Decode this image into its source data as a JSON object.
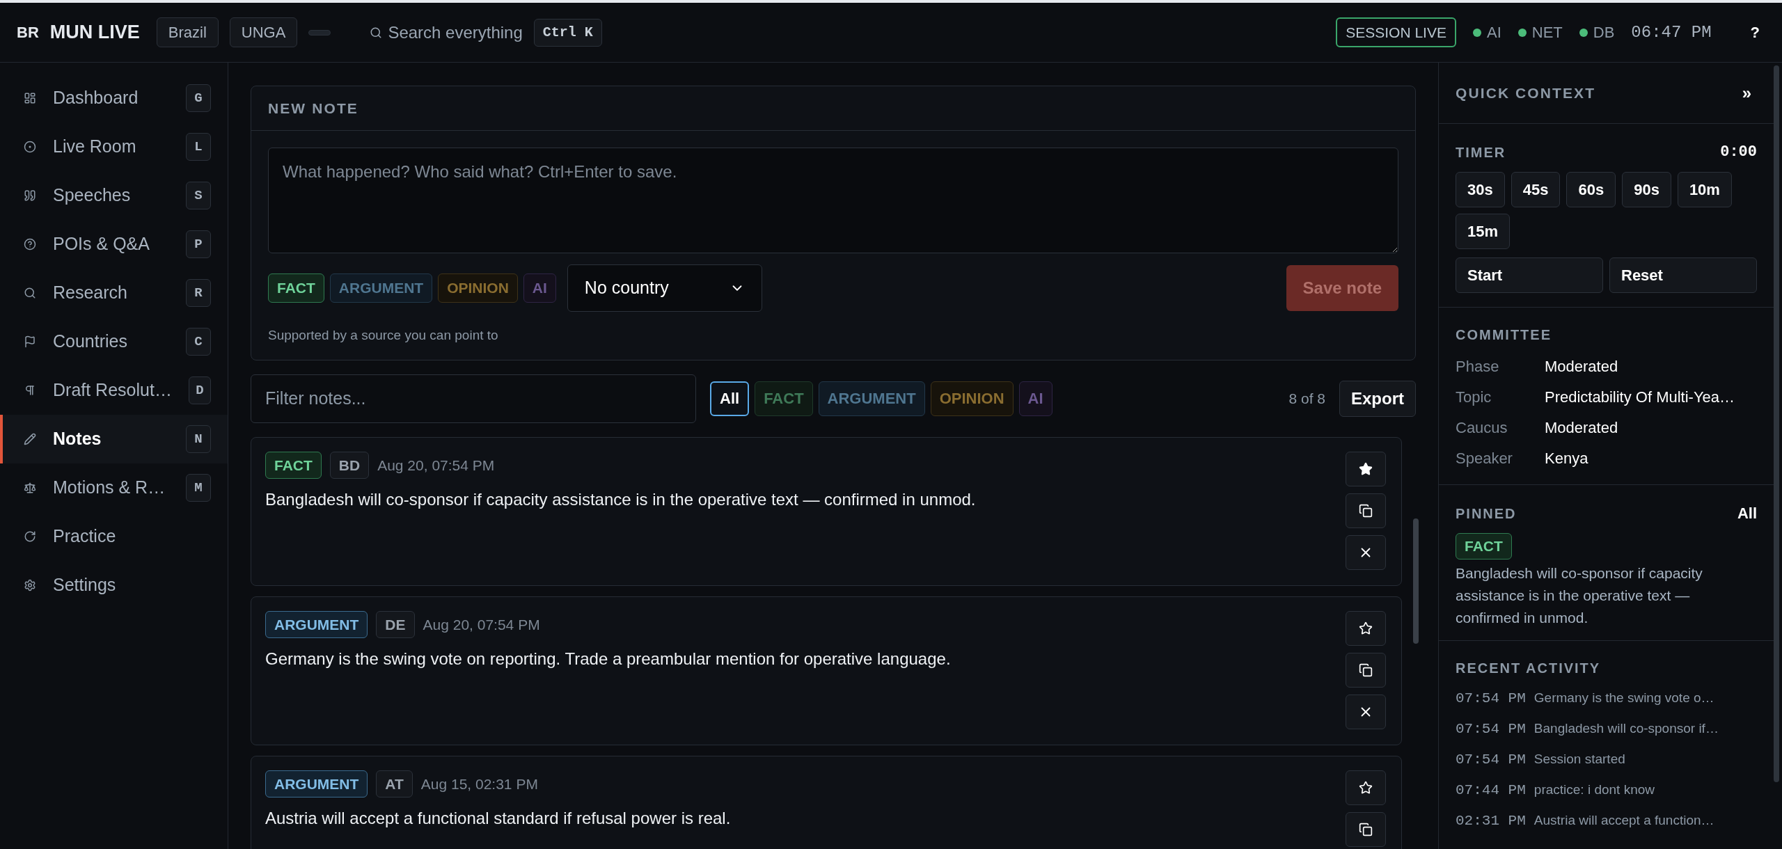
{
  "topbar": {
    "country_code": "BR",
    "title": "MUN LIVE",
    "chips": [
      "Brazil",
      "UNGA"
    ],
    "search": {
      "placeholder": "Search everything",
      "shortcut": "Ctrl K"
    },
    "session": "SESSION LIVE",
    "status": [
      {
        "label": "AI",
        "on": true
      },
      {
        "label": "NET",
        "on": true
      },
      {
        "label": "DB",
        "on": true
      }
    ],
    "clock": "06:47 PM",
    "help": "?"
  },
  "sidebar": {
    "items": [
      {
        "label": "Dashboard",
        "key": "G",
        "selected": false
      },
      {
        "label": "Live Room",
        "key": "L",
        "selected": false
      },
      {
        "label": "Speeches",
        "key": "S",
        "selected": false
      },
      {
        "label": "POIs & Q&A",
        "key": "P",
        "selected": false
      },
      {
        "label": "Research",
        "key": "R",
        "selected": false
      },
      {
        "label": "Countries",
        "key": "C",
        "selected": false
      },
      {
        "label": "Draft Resolut…",
        "key": "D",
        "selected": false
      },
      {
        "label": "Notes",
        "key": "N",
        "selected": true
      },
      {
        "label": "Motions & R…",
        "key": "M",
        "selected": false
      },
      {
        "label": "Practice",
        "selected": false
      },
      {
        "label": "Settings",
        "selected": false
      }
    ]
  },
  "new_note": {
    "title": "NEW NOTE",
    "placeholder": "What happened? Who said what? Ctrl+Enter to save.",
    "tags": [
      {
        "label": "FACT",
        "kind": "fact",
        "selected": true
      },
      {
        "label": "ARGUMENT",
        "kind": "argument",
        "selected": false
      },
      {
        "label": "OPINION",
        "kind": "opinion",
        "selected": false
      },
      {
        "label": "AI",
        "kind": "ai",
        "selected": false
      }
    ],
    "country": "No country",
    "save": {
      "label": "Save note",
      "disabled": true
    },
    "hint": "Supported by a source you can point to"
  },
  "filter": {
    "placeholder": "Filter notes...",
    "chips": [
      {
        "label": "All",
        "kind": "all",
        "selected": true
      },
      {
        "label": "FACT",
        "kind": "fact",
        "selected": false
      },
      {
        "label": "ARGUMENT",
        "kind": "argument",
        "selected": false
      },
      {
        "label": "OPINION",
        "kind": "opinion",
        "selected": false
      },
      {
        "label": "AI",
        "kind": "ai",
        "selected": false
      }
    ],
    "count": "8 of 8",
    "export": "Export"
  },
  "notes": [
    {
      "tag": {
        "label": "FACT",
        "kind": "fact"
      },
      "country": "BD",
      "time": "Aug 20, 07:54 PM",
      "text": "Bangladesh will co-sponsor if capacity assistance is in the operative text — confirmed in unmod.",
      "starred": true
    },
    {
      "tag": {
        "label": "ARGUMENT",
        "kind": "argument"
      },
      "country": "DE",
      "time": "Aug 20, 07:54 PM",
      "text": "Germany is the swing vote on reporting. Trade a preambular mention for operative language.",
      "starred": false
    },
    {
      "tag": {
        "label": "ARGUMENT",
        "kind": "argument"
      },
      "country": "AT",
      "time": "Aug 15, 02:31 PM",
      "text": "Austria will accept a functional standard if refusal power is real.",
      "starred": false
    }
  ],
  "quick_context": {
    "title": "QUICK CONTEXT",
    "collapse": "»",
    "timer": {
      "title": "TIMER",
      "value": "0:00",
      "presets": [
        "30s",
        "45s",
        "60s",
        "90s",
        "10m",
        "15m"
      ],
      "start": "Start",
      "reset": "Reset"
    },
    "committee": {
      "title": "COMMITTEE",
      "rows": [
        {
          "label": "Phase",
          "value": "Moderated"
        },
        {
          "label": "Topic",
          "value": "Predictability Of Multi-Yea…"
        },
        {
          "label": "Caucus",
          "value": "Moderated"
        },
        {
          "label": "Speaker",
          "value": "Kenya"
        }
      ]
    },
    "pinned": {
      "title": "PINNED",
      "all": "All",
      "tag": {
        "label": "FACT",
        "kind": "fact"
      },
      "text": "Bangladesh will co-sponsor if capacity assistance is in the operative text — confirmed in unmod."
    },
    "recent": {
      "title": "RECENT ACTIVITY",
      "rows": [
        {
          "time": "07:54 PM",
          "text": "Germany is the swing vote o…"
        },
        {
          "time": "07:54 PM",
          "text": "Bangladesh will co-sponsor if…"
        },
        {
          "time": "07:54 PM",
          "text": "Session started"
        },
        {
          "time": "07:44 PM",
          "text": "practice: i dont know"
        },
        {
          "time": "02:31 PM",
          "text": "Austria will accept a function…"
        }
      ]
    }
  }
}
